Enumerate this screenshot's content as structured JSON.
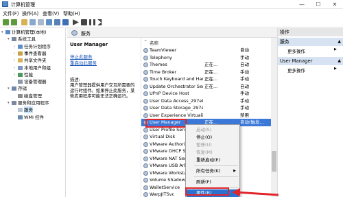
{
  "window": {
    "title": "计算机管理",
    "minimize": "—",
    "maximize": "☐",
    "close": "✕"
  },
  "menu": [
    "文件(F)",
    "操作(A)",
    "查看(V)",
    "帮助(H)"
  ],
  "tree": [
    {
      "label": "计算机管理(本地)",
      "level": 0,
      "twisty": "▾"
    },
    {
      "label": "系统工具",
      "level": 1,
      "twisty": "▾"
    },
    {
      "label": "任务计划程序",
      "level": 2,
      "twisty": "›"
    },
    {
      "label": "事件查看器",
      "level": 2,
      "twisty": "›"
    },
    {
      "label": "共享文件夹",
      "level": 2,
      "twisty": "›"
    },
    {
      "label": "本地用户和组",
      "level": 2,
      "twisty": "›"
    },
    {
      "label": "性能",
      "level": 2,
      "twisty": "›"
    },
    {
      "label": "设备管理器",
      "level": 2,
      "twisty": ""
    },
    {
      "label": "存储",
      "level": 1,
      "twisty": "▾"
    },
    {
      "label": "磁盘管理",
      "level": 2,
      "twisty": ""
    },
    {
      "label": "服务和应用程序",
      "level": 1,
      "twisty": "▾"
    },
    {
      "label": "服务",
      "level": 2,
      "twisty": "",
      "selected": true
    },
    {
      "label": "WMI 控件",
      "level": 2,
      "twisty": ""
    }
  ],
  "center": {
    "header": "服务",
    "service_name": "User Manager",
    "link_stop": "停止此服务",
    "link_restart": "重启动此服务",
    "desc_label": "描述:",
    "desc_text": "用户管理器提供用户交互所需要的运行时组件。如果停止此服务，某些应用程序可能无法正确运行。"
  },
  "list": {
    "col_name": "名称",
    "rows": [
      {
        "name": "TeamViewer",
        "status": "",
        "type": "自动"
      },
      {
        "name": "Telephony",
        "status": "",
        "type": "手动"
      },
      {
        "name": "Themes",
        "status": "正在...",
        "type": "自动"
      },
      {
        "name": "Time Broker",
        "status": "正在...",
        "type": "手动"
      },
      {
        "name": "Touch Keyboard and Han...",
        "status": "正在...",
        "type": "手动"
      },
      {
        "name": "Update Orchestrator Ser...",
        "status": "正在...",
        "type": "自动"
      },
      {
        "name": "UPnP Device Host",
        "status": "",
        "type": "手动"
      },
      {
        "name": "User Data Access_297e8c...",
        "status": "",
        "type": "手动"
      },
      {
        "name": "User Data Storage_297e8...",
        "status": "",
        "type": "手动"
      },
      {
        "name": "User Experience Virtualiz...",
        "status": "",
        "type": "禁用"
      },
      {
        "name": "User Manager",
        "status": "正在...",
        "type": "自动(触发...",
        "selected": true
      },
      {
        "name": "User Profile Servi...",
        "status": "",
        "type": ""
      },
      {
        "name": "Virtual Disk",
        "status": "",
        "type": ""
      },
      {
        "name": "VMware Authoriz...",
        "status": "",
        "type": ""
      },
      {
        "name": "VMware DHCP Se...",
        "status": "",
        "type": ""
      },
      {
        "name": "VMware NAT Ser...",
        "status": "",
        "type": ""
      },
      {
        "name": "VMware USB Arb...",
        "status": "",
        "type": ""
      },
      {
        "name": "VMware Worksta...",
        "status": "",
        "type": ""
      },
      {
        "name": "Volume Shadow...",
        "status": "",
        "type": ""
      },
      {
        "name": "WalletService",
        "status": "",
        "type": ""
      },
      {
        "name": "WarpJITSvc",
        "status": "",
        "type": ""
      }
    ]
  },
  "context_menu": [
    {
      "label": "启动(S)",
      "disabled": true
    },
    {
      "label": "停止(O)",
      "disabled": false
    },
    {
      "label": "暂停(U)",
      "disabled": true
    },
    {
      "label": "恢复(M)",
      "disabled": true
    },
    {
      "label": "重新启动(E)",
      "disabled": false
    },
    {
      "sep": true
    },
    {
      "label": "所有任务(K)",
      "disabled": false,
      "submenu": true
    },
    {
      "sep": true
    },
    {
      "label": "刷新(F)",
      "disabled": false
    },
    {
      "sep": true
    },
    {
      "label": "属性(R)",
      "disabled": false,
      "highlighted": true
    }
  ],
  "actions": {
    "header1": "操作",
    "section1": "服务",
    "more1": "更多操作",
    "section2": "User Manager",
    "more2": "更多操作"
  },
  "colors": {
    "selection": "#3b78d8",
    "annotation": "#e0252b",
    "link": "#1a56b8"
  }
}
